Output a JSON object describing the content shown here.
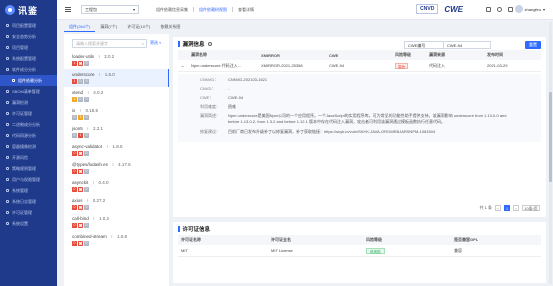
{
  "brand": {
    "name": "讯鉴"
  },
  "sidebar": {
    "items": [
      {
        "label": "项目配置管理",
        "sub": false,
        "active": false
      },
      {
        "label": "安全态势分析",
        "sub": false,
        "active": false
      },
      {
        "label": "项目管理",
        "sub": false,
        "active": false
      },
      {
        "label": "系统配置管理",
        "sub": false,
        "active": false
      },
      {
        "label": "软件成分分析",
        "sub": false,
        "active": false
      },
      {
        "label": "组件依赖分析",
        "sub": true,
        "active": true
      },
      {
        "label": "SBOM清单管理",
        "sub": false,
        "active": false
      },
      {
        "label": "漏洞检测",
        "sub": false,
        "active": false
      },
      {
        "label": "许可证管理",
        "sub": false,
        "active": false
      },
      {
        "label": "二进制成分分析",
        "sub": false,
        "active": false
      },
      {
        "label": "代码同源分析",
        "sub": false,
        "active": false
      },
      {
        "label": "容器镜像检测",
        "sub": false,
        "active": false
      },
      {
        "label": "开源风险",
        "sub": false,
        "active": false
      },
      {
        "label": "策略规则管理",
        "sub": false,
        "active": false
      },
      {
        "label": "用户与权限管理",
        "sub": false,
        "active": false
      },
      {
        "label": "系统管理",
        "sub": false,
        "active": false
      },
      {
        "label": "系统日志管理",
        "sub": false,
        "active": false
      },
      {
        "label": "许可证管理",
        "sub": false,
        "active": false
      },
      {
        "label": "系统设置",
        "sub": false,
        "active": false
      }
    ]
  },
  "topbar": {
    "project": "工程包",
    "tabs": [
      "组件依赖信息采集",
      "组件依赖树视图",
      "查看详情"
    ],
    "logo_a": "CNVD",
    "logo_b": "CWE",
    "username": "zhangfeu"
  },
  "subtabs": [
    "组件(264个)",
    "漏洞(7个)",
    "许可证(10个)",
    "依赖关系图"
  ],
  "components": {
    "search_placeholder": "请输入搜索关键字",
    "filter_label": "筛选",
    "items": [
      {
        "name": "loader-utils",
        "version": "2.0.2",
        "badges": [
          [
            "h",
            "1"
          ],
          [
            "w",
            "0"
          ],
          [
            "l",
            "0"
          ]
        ]
      },
      {
        "name": "underscore",
        "version": "1.6.0",
        "badges": [
          [
            "h",
            "1"
          ],
          [
            "l",
            "0"
          ],
          [
            "l",
            "0"
          ]
        ]
      },
      {
        "name": "xtend",
        "version": "4.0.2",
        "badges": [
          [
            "m",
            "1"
          ],
          [
            "l",
            "0"
          ],
          [
            "l",
            "0"
          ]
        ]
      },
      {
        "name": "is",
        "version": "0.18.5",
        "badges": [
          [
            "l",
            "0"
          ],
          [
            "m",
            "1"
          ],
          [
            "l",
            "0"
          ]
        ]
      },
      {
        "name": "json5",
        "version": "2.2.1",
        "badges": [
          [
            "l",
            "0"
          ],
          [
            "h",
            "1"
          ],
          [
            "l",
            "0"
          ]
        ]
      },
      {
        "name": "async-validator",
        "version": "1.8.5",
        "badges": [
          [
            "h",
            "0"
          ],
          [
            "w",
            "0"
          ],
          [
            "l",
            "0"
          ]
        ]
      },
      {
        "name": "@types/lodash.es",
        "version": "4.17.6",
        "badges": [
          [
            "h",
            "0"
          ],
          [
            "w",
            "0"
          ],
          [
            "l",
            "0"
          ]
        ]
      },
      {
        "name": "asynckit",
        "version": "0.4.0",
        "badges": [
          [
            "h",
            "0"
          ],
          [
            "w",
            "0"
          ],
          [
            "l",
            "0"
          ]
        ]
      },
      {
        "name": "axios",
        "version": "0.27.2",
        "badges": [
          [
            "h",
            "0"
          ],
          [
            "w",
            "0"
          ],
          [
            "l",
            "0"
          ]
        ]
      },
      {
        "name": "call-bind",
        "version": "1.0.2",
        "badges": [
          [
            "h",
            "0"
          ],
          [
            "w",
            "0"
          ],
          [
            "l",
            "0"
          ]
        ]
      },
      {
        "name": "combined-stream",
        "version": "1.0.8",
        "badges": [
          [
            "h",
            "0"
          ],
          [
            "w",
            "0"
          ],
          [
            "l",
            "0"
          ]
        ]
      }
    ]
  },
  "vulns": {
    "title": "漏洞信息",
    "search_type": "CWE编号",
    "search_value": "CWE-94",
    "reset_label": "重置",
    "headers": [
      "漏洞名称",
      "XMIRROR",
      "CWE",
      "风险等级",
      "漏洞来源",
      "发布时间"
    ],
    "row": {
      "name": "Npm underscore 代码注入...",
      "xmirror": "XMIRROR-2021-25358",
      "cwe": "CWE-94",
      "risk": "高危",
      "source": "代码注入",
      "date": "2021-03-29"
    },
    "detail": [
      {
        "label": "CNNVD：",
        "value": "CNNVD-202103-1621"
      },
      {
        "label": "CNVD：",
        "value": "-"
      },
      {
        "label": "CWE：",
        "value": "CWE-94"
      },
      {
        "label": "利用难度：",
        "value": "困难"
      },
      {
        "label": "漏洞简述：",
        "value": "Npm underscore是美国Npm公司的一个应用程序。一个JavaScript的实用程序库。可为常见的功能性助手提供支持。该漏洞影响 underscore from 1.13.0-0 and before 1.13.0-2, from 1.3.2 and before 1.12.1 版本中存在代码注入漏洞，攻击者可利用该漏洞通过模板函数执行任意代码。"
      },
      {
        "label": "修复建议：",
        "value": "目前厂商已发布升级补丁以修复漏洞，补丁获取链接：https://snyk.io/vuln/SNYK-JAVA-ORGWEBJARSNPM-1081504"
      }
    ],
    "pager": {
      "total": "共 1 条",
      "page": "1",
      "size": "10条/页"
    }
  },
  "licenses": {
    "title": "许可证信息",
    "headers": [
      "许可证名称",
      "许可证全名",
      "风险等级",
      "是否兼容GPL"
    ],
    "row": {
      "name": "MIT",
      "full": "MIT License",
      "risk": "低风险",
      "gpl": "兼容"
    }
  }
}
